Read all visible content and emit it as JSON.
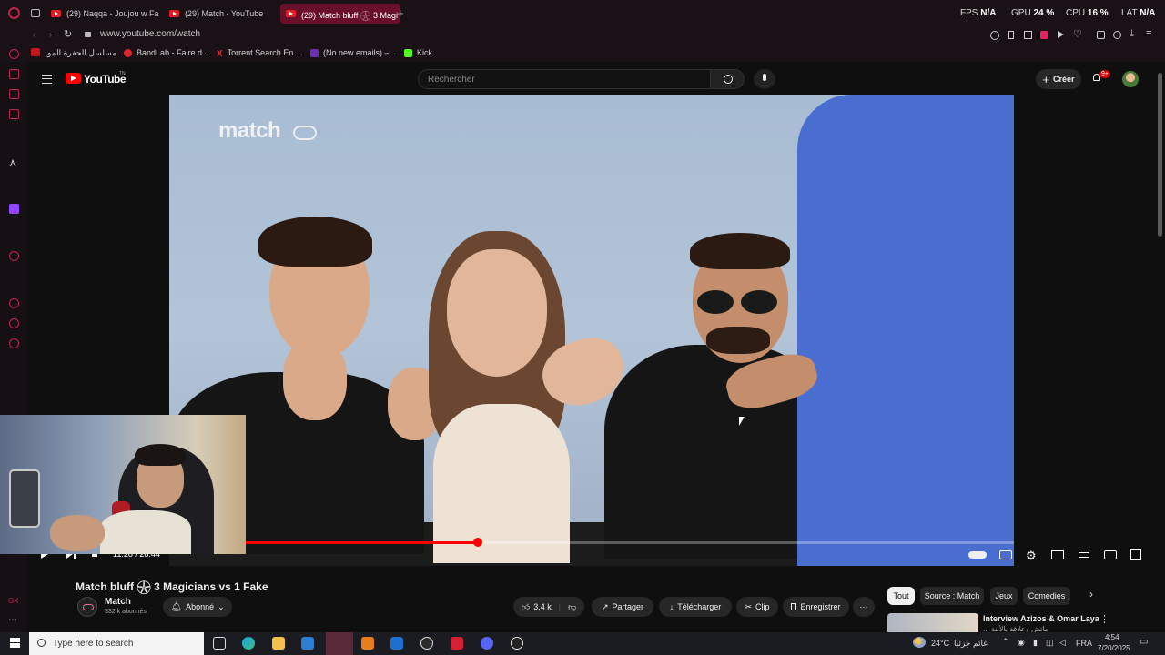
{
  "browser": {
    "tabs": [
      {
        "label": "(29) Naqqa - Joujou w Fa",
        "active": false
      },
      {
        "label": "(29) Match - YouTube",
        "active": false
      },
      {
        "label": "(29) Match bluff 𓇽 3 Magi",
        "active": true
      }
    ],
    "stats": {
      "fps_label": "FPS",
      "fps_value": "N/A",
      "gpu_label": "GPU",
      "gpu_value": "24 %",
      "cpu_label": "CPU",
      "cpu_value": "16 %",
      "lat_label": "LAT",
      "lat_value": "N/A"
    },
    "url": "www.youtube.com/watch",
    "bookmarks": [
      {
        "label": "مسلسل الحفرة المو...",
        "color": "#c4161c"
      },
      {
        "label": "BandLab - Faire d...",
        "color": "#e0262d"
      },
      {
        "label": "Torrent Search En...",
        "color": "#d92a2a"
      },
      {
        "label": "(No new emails) –...",
        "color": "#6b2fb3"
      },
      {
        "label": "Kick",
        "color": "#53fc18"
      }
    ]
  },
  "youtube": {
    "logo_text": "YouTube",
    "logo_sup": "TN",
    "search_placeholder": "Rechercher",
    "create_label": "Créer",
    "notif_badge": "9+"
  },
  "video": {
    "watermark": "match",
    "time": "11:28 / 28:44",
    "progress": 0.365
  },
  "details": {
    "title": "Match bluff 𓇽 3 Magicians vs 1 Fake",
    "channel": "Match",
    "subscribers": "332 k abonnés",
    "subscribed_label": "Abonné",
    "likes": "3,4 k",
    "share_label": "Partager",
    "download_label": "Télécharger",
    "clip_label": "Clip",
    "save_label": "Enregistrer"
  },
  "chips": [
    {
      "label": "Tout",
      "active": true
    },
    {
      "label": "Source : Match",
      "active": false
    },
    {
      "label": "Jeux",
      "active": false
    },
    {
      "label": "Comédies",
      "active": false
    }
  ],
  "recommended": {
    "title": "Interview Azizos & Omar Laya",
    "subtitle": "... ماتش وعلاقة بالأبنة"
  },
  "taskbar": {
    "search_placeholder": "Type here to search",
    "weather": "24°C",
    "weather_text": "غائم جزئيا",
    "lang": "FRA",
    "time": "4:54",
    "date": "7/20/2025"
  },
  "colors": {
    "accent": "#ff0000",
    "opera": "#c0234d"
  }
}
